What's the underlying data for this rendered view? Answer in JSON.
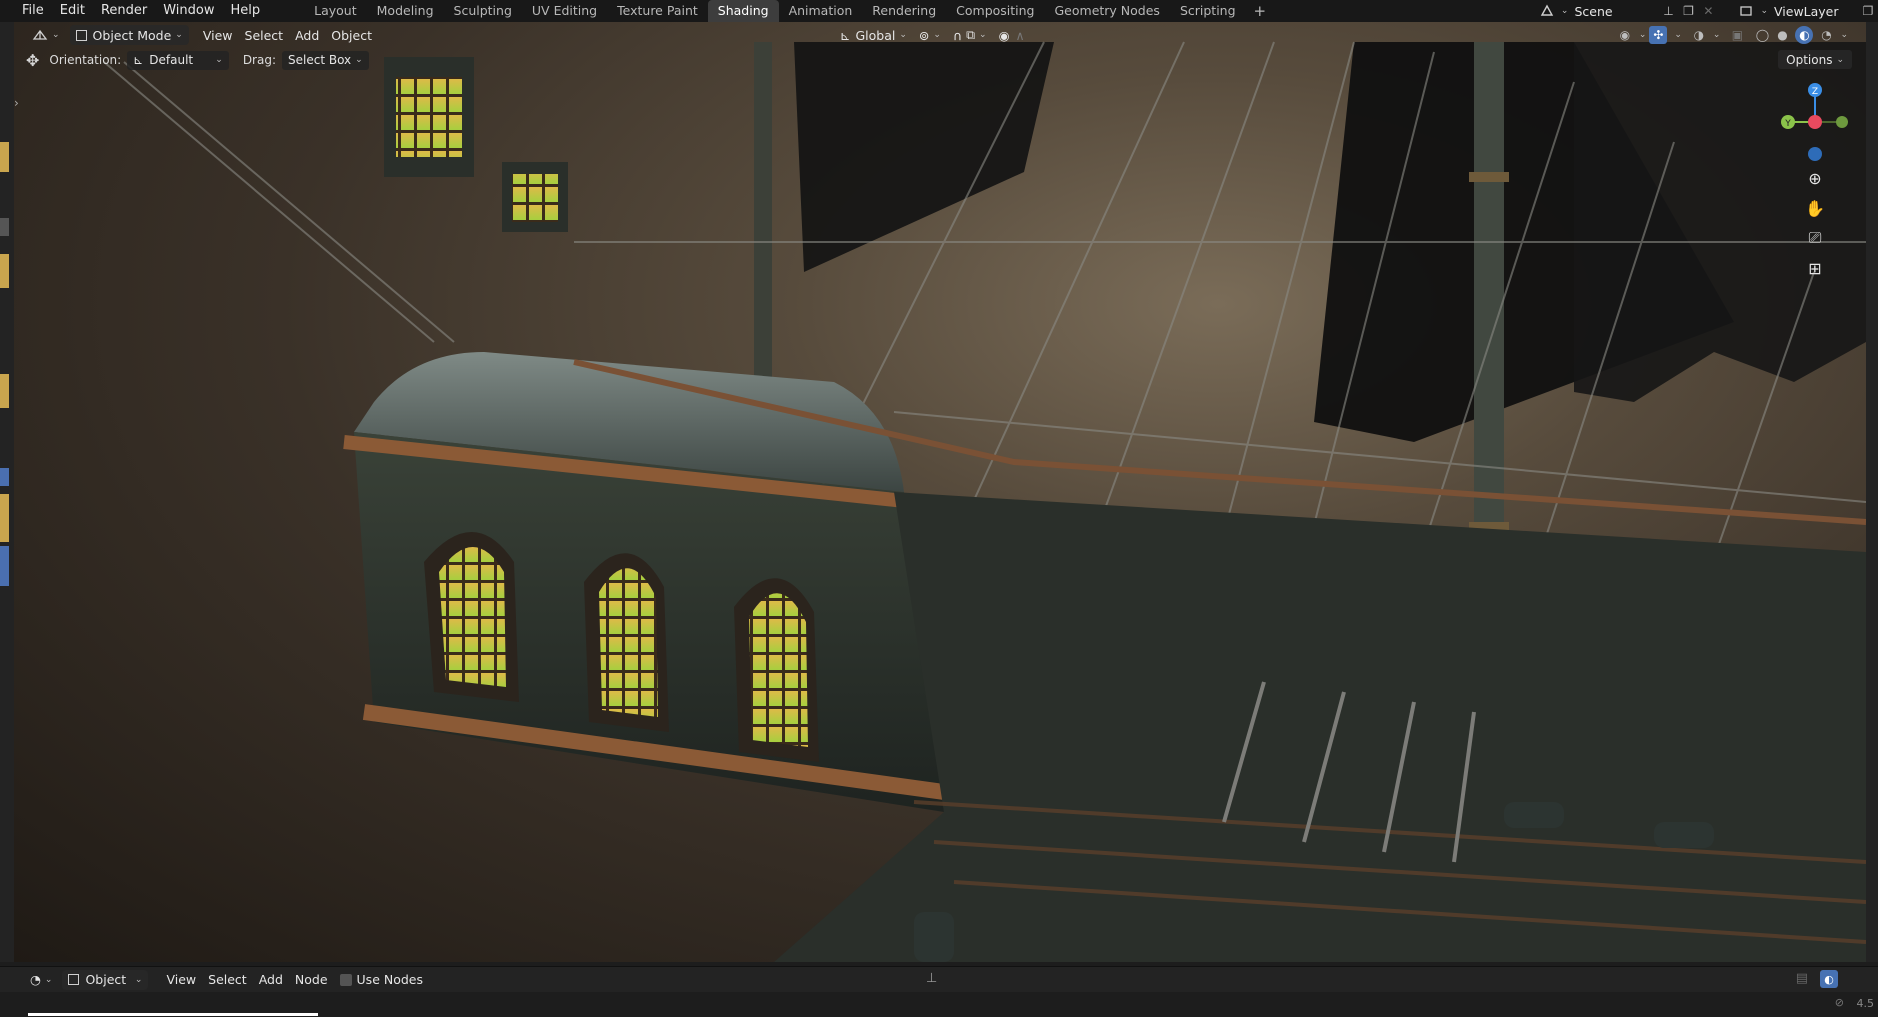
{
  "top_menu": [
    "File",
    "Edit",
    "Render",
    "Window",
    "Help"
  ],
  "workspaces": [
    "Layout",
    "Modeling",
    "Sculpting",
    "UV Editing",
    "Texture Paint",
    "Shading",
    "Animation",
    "Rendering",
    "Compositing",
    "Geometry Nodes",
    "Scripting"
  ],
  "active_workspace": "Shading",
  "add_workspace": "+",
  "scene_name": "Scene",
  "view_layer": "ViewLayer",
  "viewport_header": {
    "mode": "Object Mode",
    "menus": [
      "View",
      "Select",
      "Add",
      "Object"
    ],
    "transform_orientation": "Global",
    "options_label": "Options"
  },
  "tool_settings": {
    "orientation_label": "Orientation:",
    "orientation_value": "Default",
    "drag_label": "Drag:",
    "drag_value": "Select Box"
  },
  "gizmo": {
    "z": "Z",
    "y": "Y"
  },
  "bottom_header": {
    "editor_type": "Object",
    "menus": [
      "View",
      "Select",
      "Add",
      "Node"
    ],
    "use_nodes_label": "Use Nodes"
  },
  "version_text": "4.5",
  "colors": {
    "accent_blue": "#4772b3",
    "axis_x": "#e84a5f",
    "axis_y": "#8bc34a",
    "axis_z": "#3a8ee6",
    "window_glow": "#b8d646"
  }
}
